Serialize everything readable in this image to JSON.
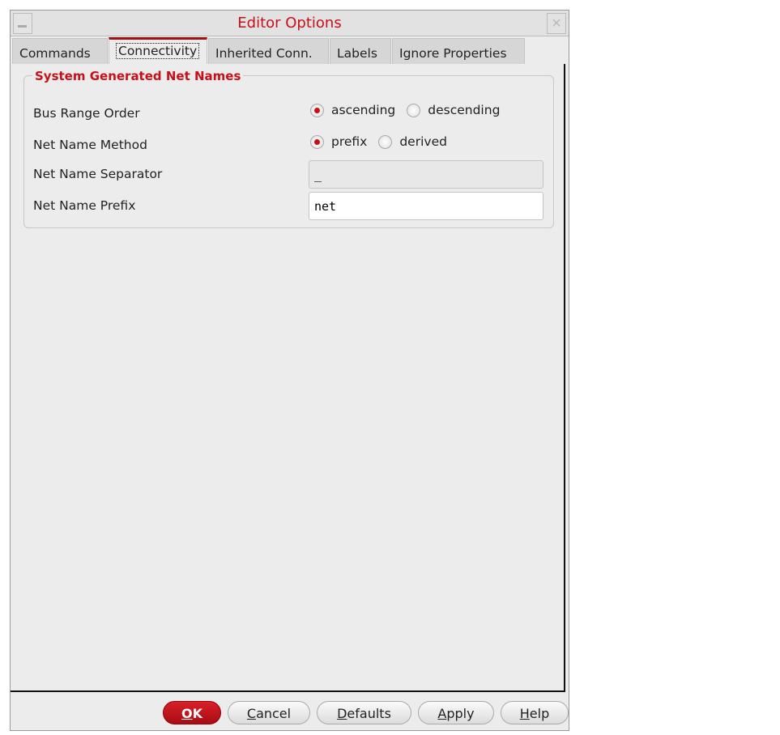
{
  "window": {
    "title": "Editor Options"
  },
  "tabs": [
    {
      "label": "Commands"
    },
    {
      "label": "Connectivity",
      "active": true
    },
    {
      "label": "Inherited Conn."
    },
    {
      "label": "Labels"
    },
    {
      "label": "Ignore Properties"
    }
  ],
  "group": {
    "title": "System Generated Net Names",
    "bus_range_order": {
      "label": "Bus Range Order",
      "options": [
        "ascending",
        "descending"
      ],
      "selected": "ascending"
    },
    "net_name_method": {
      "label": "Net Name Method",
      "options": [
        "prefix",
        "derived"
      ],
      "selected": "prefix"
    },
    "net_name_separator": {
      "label": "Net Name Separator",
      "value": "_"
    },
    "net_name_prefix": {
      "label": "Net Name Prefix",
      "value": "net"
    }
  },
  "buttons": {
    "ok": {
      "m": "O",
      "rest": "K"
    },
    "cancel": {
      "m": "C",
      "rest": "ancel"
    },
    "defaults": {
      "m": "D",
      "rest": "efaults"
    },
    "apply": {
      "m": "A",
      "rest": "pply"
    },
    "help": {
      "m": "H",
      "rest": "elp"
    }
  }
}
